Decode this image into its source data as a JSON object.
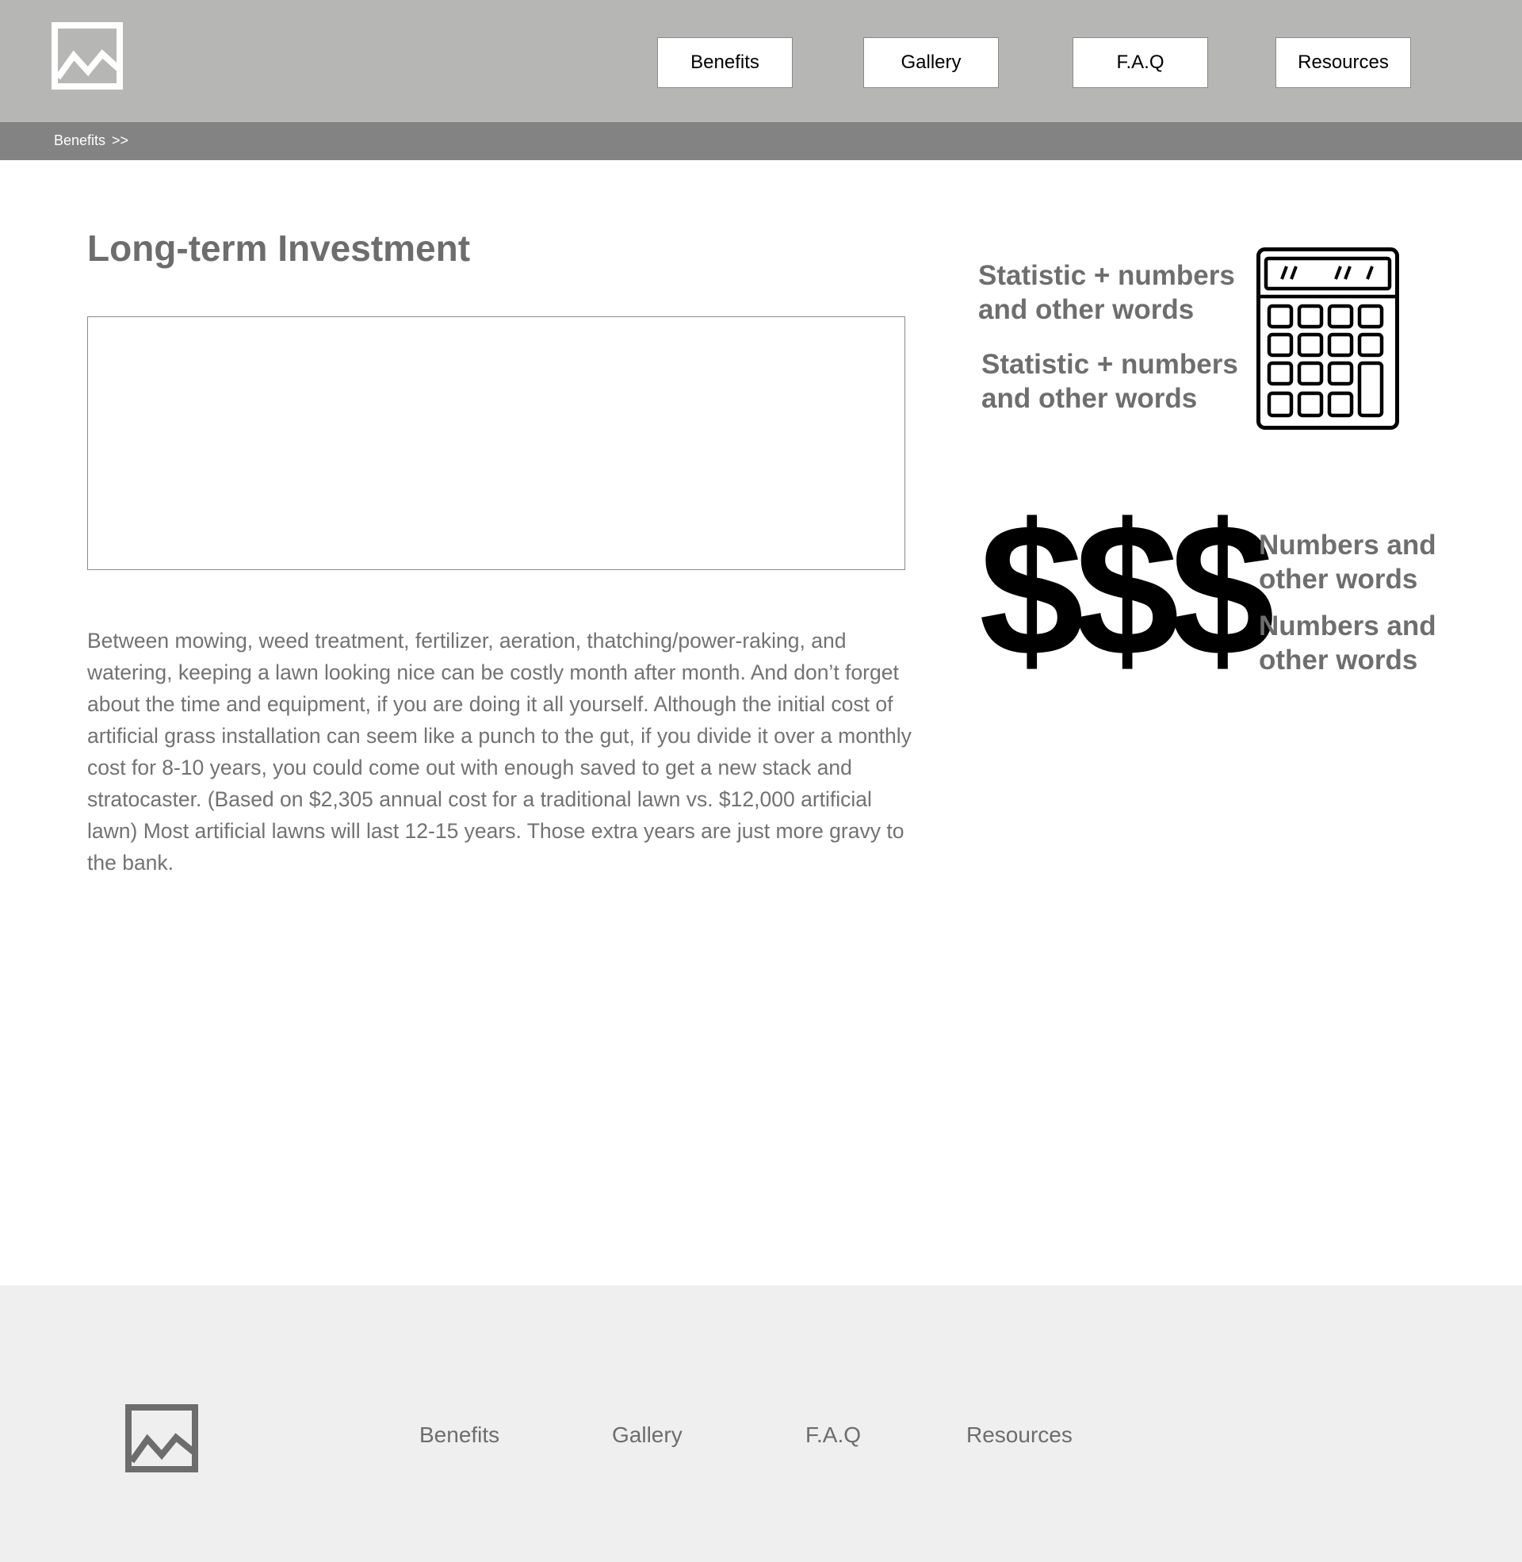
{
  "header": {
    "logo_icon": "image-placeholder-icon",
    "nav": [
      {
        "label": "Benefits"
      },
      {
        "label": "Gallery"
      },
      {
        "label": "F.A.Q"
      },
      {
        "label": "Resources"
      }
    ]
  },
  "breadcrumb": {
    "current": "Benefits",
    "separator": ">>"
  },
  "main": {
    "title": "Long-term Investment",
    "body": "Between mowing, weed treatment, fertilizer, aeration, thatching/power-raking, and watering, keeping a lawn looking nice can be costly month after month. And don’t forget about the time and equipment, if you are doing it all yourself. Although the initial cost of artificial grass installation can seem like a punch to the gut, if you divide it over a monthly cost for 8-10 years, you could come out with enough saved to get a new stack and stratocaster. (Based on $2,305 annual cost for a traditional lawn vs. $12,000 artificial lawn) Most artificial lawns will last 12-15 years. Those extra years are just more gravy to the bank."
  },
  "sidebar": {
    "calculator_stats": [
      "Statistic + numbers and other words",
      "Statistic + numbers and other words"
    ],
    "calculator_icon": "calculator-icon",
    "dollar_glyph": "$$$",
    "dollar_stats": [
      "Numbers and other words",
      "Numbers and other words"
    ]
  },
  "footer": {
    "logo_icon": "image-placeholder-icon",
    "links": [
      {
        "label": "Benefits"
      },
      {
        "label": "Gallery"
      },
      {
        "label": "F.A.Q"
      },
      {
        "label": "Resources"
      }
    ]
  },
  "colors": {
    "header_bg": "#b6b6b5",
    "breadcrumb_bg": "#838383",
    "footer_bg": "#efefef",
    "text_gray": "#6d6d6d"
  }
}
